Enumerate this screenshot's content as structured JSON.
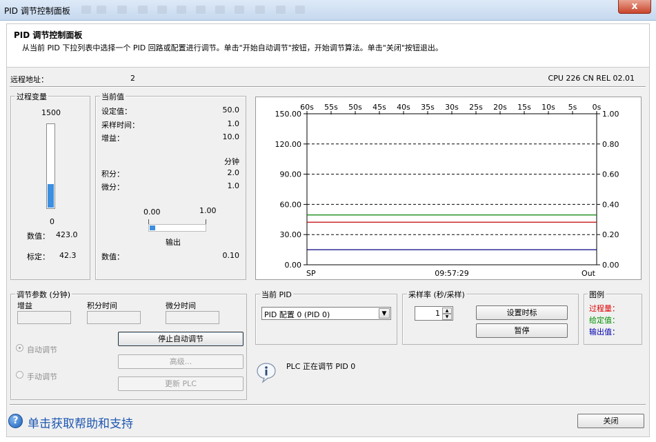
{
  "window": {
    "title": "PID 调节控制面板",
    "close_label": "x"
  },
  "header": {
    "title": "PID 调节控制面板",
    "description": "从当前 PID 下拉列表中选择一个 PID 回路或配置进行调节。单击\"开始自动调节\"按钮，开始调节算法。单击\"关闭\"按钮退出。"
  },
  "remote": {
    "label": "远程地址：",
    "value": "2",
    "cpu": "CPU 226 CN REL 02.01"
  },
  "process_var": {
    "group_label": "过程变量",
    "top_value": "1500",
    "bottom_value": "0",
    "fill_fraction": 0.28,
    "value_label": "数值：",
    "value": "423.0",
    "scaled_label": "标定：",
    "scaled": "42.3"
  },
  "current": {
    "group_label": "当前值",
    "setpoint_label": "设定值：",
    "setpoint": "50.0",
    "sample_label": "采样时间：",
    "sample": "1.0",
    "gain_label": "增益：",
    "gain": "10.0",
    "minutes_label": "分钟",
    "integral_label": "积分：",
    "integral": "2.0",
    "derivative_label": "微分：",
    "derivative": "1.0",
    "slider_min": "0.00",
    "slider_max": "1.00",
    "output_fraction": 0.1,
    "output_label": "输出",
    "value_label": "数值：",
    "value": "0.10"
  },
  "chart_data": {
    "type": "line",
    "x_ticks": [
      "60s",
      "55s",
      "50s",
      "45s",
      "40s",
      "35s",
      "30s",
      "25s",
      "20s",
      "15s",
      "10s",
      "5s",
      "0s"
    ],
    "y_left_ticks": [
      "150.00",
      "120.00",
      "90.00",
      "60.00",
      "30.00",
      "0.00"
    ],
    "y_right_ticks": [
      "1.00",
      "0.80",
      "0.60",
      "0.40",
      "0.20",
      "0.00"
    ],
    "ylim_left": [
      0,
      150
    ],
    "ylim_right": [
      0,
      1
    ],
    "left_axis_label": "SP",
    "right_axis_label": "Out",
    "time_label": "09:57:29",
    "grid": "dashed horizontal",
    "series": [
      {
        "axis": "left",
        "value": 49.5,
        "color": "#008000"
      },
      {
        "axis": "left",
        "value": 42.3,
        "color": "#c00000"
      },
      {
        "axis": "right",
        "value": 0.1,
        "color": "#00007f"
      }
    ]
  },
  "tuning": {
    "group_label": "调节参数 (分钟)",
    "gain_label": "增益",
    "integral_label": "积分时间",
    "derivative_label": "微分时间",
    "auto_label": "自动调节",
    "manual_label": "手动调节",
    "stop_button": "停止自动调节",
    "advanced_button": "高级...",
    "update_button": "更新 PLC"
  },
  "pid_select": {
    "group_label": "当前 PID",
    "value": "PID 配置 0 (PID 0)"
  },
  "sample_rate": {
    "group_label": "采样率 (秒/采样)",
    "value": "1",
    "set_button": "设置时标",
    "pause_button": "暂停"
  },
  "legend": {
    "group_label": "图例",
    "pv": "过程量：",
    "sp": "给定值：",
    "out": "输出值：",
    "pv_color": "#e00000",
    "sp_color": "#009000",
    "out_color": "#0000b0"
  },
  "status": {
    "message": "PLC 正在调节 PID 0"
  },
  "footer": {
    "help": "单击获取帮助和支持",
    "close_button": "关闭"
  }
}
